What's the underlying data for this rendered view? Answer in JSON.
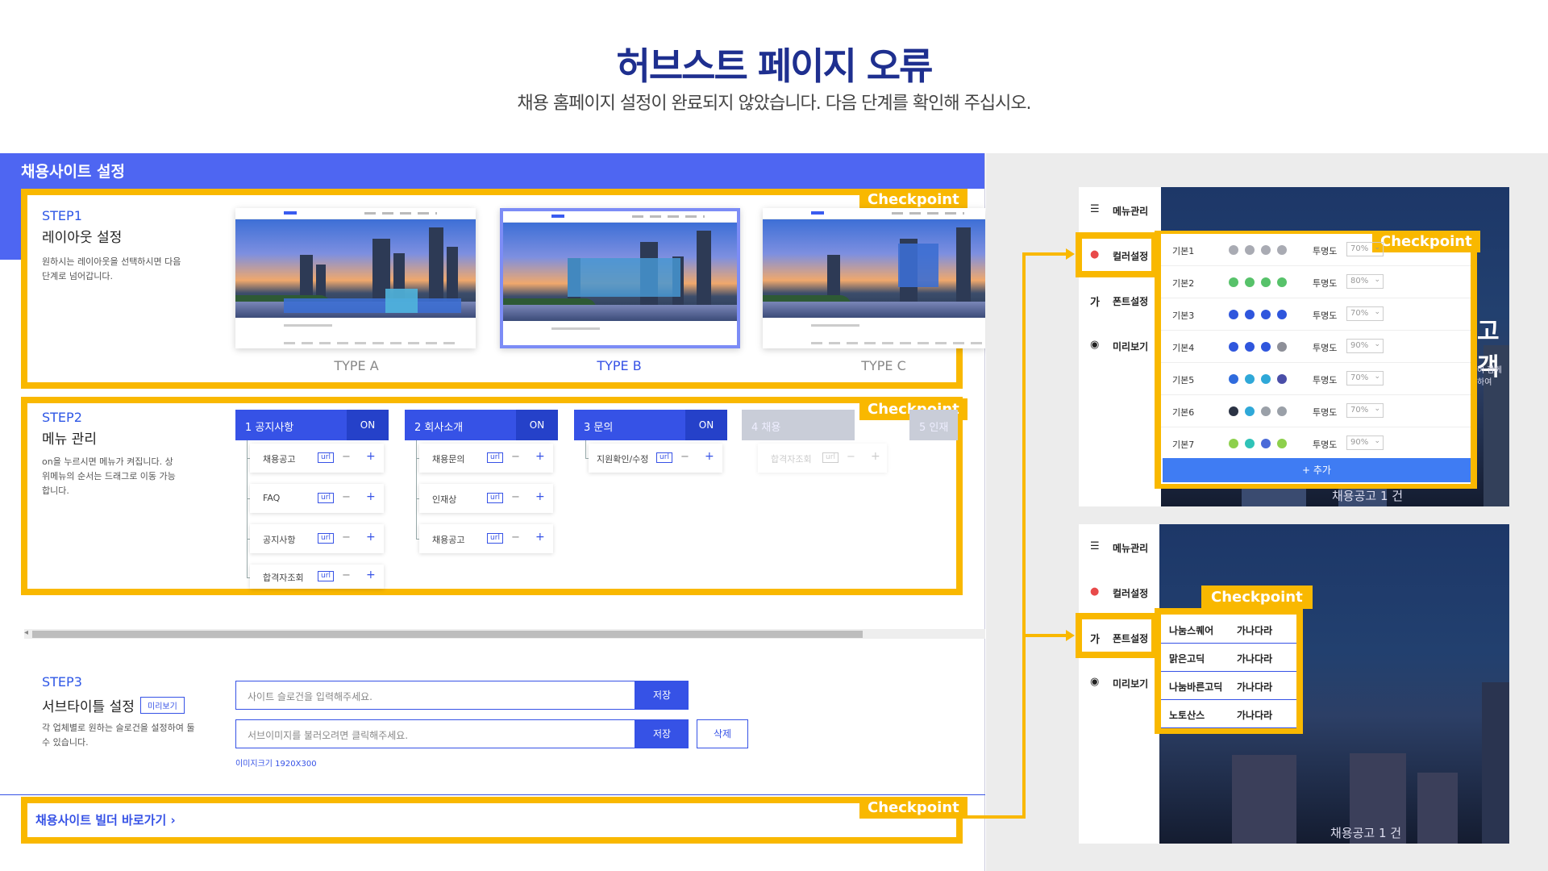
{
  "header": {
    "title": "허브스트 페이지 오류",
    "subtitle": "채용 홈페이지 설정이 완료되지 않았습니다. 다음 단계를 확인해 주십시오."
  },
  "panel": {
    "title": "채용사이트 설정"
  },
  "checkpoint_label": "Checkpoint",
  "step1": {
    "num": "STEP1",
    "name": "레이아웃 설정",
    "desc": "원하시는 레이아웃을 선택하시면 다음 단계로 넘어갑니다.",
    "types": [
      "TYPE A",
      "TYPE B",
      "TYPE C"
    ],
    "selected": "TYPE B"
  },
  "step2": {
    "num": "STEP2",
    "name": "메뉴 관리",
    "desc": "on을 누르시면 메뉴가 켜집니다. 상위메뉴의 순서는 드래그로 이동 가능합니다.",
    "menus": [
      {
        "label": "1  공지사항",
        "state": "ON",
        "items": [
          "채용공고",
          "FAQ",
          "공지사항",
          "합격자조회"
        ]
      },
      {
        "label": "2  회사소개",
        "state": "ON",
        "items": [
          "채용문의",
          "인재상",
          "채용공고"
        ]
      },
      {
        "label": "3  문의",
        "state": "ON",
        "items": [
          "지원확인/수정"
        ]
      },
      {
        "label": "4  채용",
        "state": "OFF",
        "items": [
          "합격자조회"
        ]
      },
      {
        "label": "5  인재",
        "state": ""
      }
    ],
    "url_label": "url",
    "minus": "−",
    "plus": "+"
  },
  "step3": {
    "num": "STEP3",
    "name": "서브타이틀 설정",
    "preview_chip": "미리보기",
    "desc": "각 업체별로 원하는 슬로건을 설정하여 둘 수 있습니다.",
    "slogan_placeholder": "사이트 슬로건을 입력해주세요.",
    "image_placeholder": "서브이미지를 불러오려면 클릭해주세요.",
    "save": "저장",
    "delete": "삭제",
    "image_size": "이미지크기 1920X300"
  },
  "builder_link": "채용사이트 빌더 바로가기  ›",
  "side_menu": {
    "items": [
      {
        "icon": "☰",
        "label": "메뉴관리"
      },
      {
        "icon": "●",
        "label": "컬러설정"
      },
      {
        "icon": "가",
        "label": "폰트설정"
      },
      {
        "icon": "◉",
        "label": "미리보기"
      }
    ]
  },
  "color_settings": {
    "opacity_label": "투명도",
    "rows": [
      {
        "name": "기본1",
        "colors": [
          "#a9abb3",
          "#a9abb3",
          "#a9abb3",
          "#a9abb3"
        ],
        "opacity": "70%"
      },
      {
        "name": "기본2",
        "colors": [
          "#57c26a",
          "#57c26a",
          "#57c26a",
          "#57c26a"
        ],
        "opacity": "80%"
      },
      {
        "name": "기본3",
        "colors": [
          "#2f56dd",
          "#2f56dd",
          "#2f56dd",
          "#2f56dd"
        ],
        "opacity": "70%"
      },
      {
        "name": "기본4",
        "colors": [
          "#2f56dd",
          "#2f56dd",
          "#2f56dd",
          "#8d8f98"
        ],
        "opacity": "90%"
      },
      {
        "name": "기본5",
        "colors": [
          "#2f6bdd",
          "#2fa8d8",
          "#2fa8d8",
          "#4a4ea8"
        ],
        "opacity": "70%"
      },
      {
        "name": "기본6",
        "colors": [
          "#2b3344",
          "#2fa8d8",
          "#9aa0a8",
          "#9aa0a8"
        ],
        "opacity": "70%"
      },
      {
        "name": "기본7",
        "colors": [
          "#8dd04c",
          "#2fc3b8",
          "#4a6ad8",
          "#8dd04c"
        ],
        "opacity": "90%"
      }
    ],
    "add": "+ 추가"
  },
  "font_settings": {
    "rows": [
      {
        "name": "나눔스퀘어",
        "sample": "가나다라"
      },
      {
        "name": "맑은고딕",
        "sample": "가나다라"
      },
      {
        "name": "나눔바른고딕",
        "sample": "가나다라"
      },
      {
        "name": "노토산스",
        "sample": "가나다라"
      }
    ]
  },
  "preview_texts": {
    "top_caption": "채용공고 1 건",
    "bottom_caption": "채용공고 1 건",
    "big_text": "고객",
    "small_text": "이 함께 하여"
  },
  "colors": {
    "accent": "#3652e6",
    "checkpoint": "#f9b800",
    "band": "#4e66f2"
  }
}
